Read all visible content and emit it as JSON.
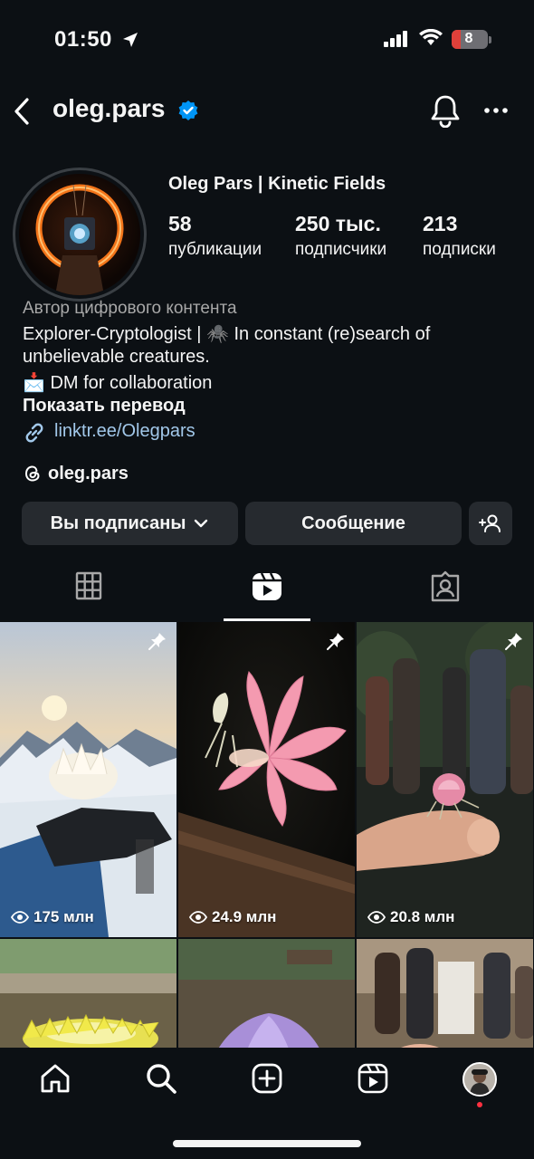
{
  "status_bar": {
    "time": "01:50",
    "battery_level": "8",
    "icons": [
      "location-arrow-icon",
      "signal-icon",
      "wifi-icon",
      "battery-icon"
    ]
  },
  "header": {
    "username": "oleg.pars",
    "verified": true,
    "icons": [
      "back-icon",
      "verified-icon",
      "bell-icon",
      "more-icon"
    ]
  },
  "profile": {
    "display_name": "Oleg Pars | Kinetic Fields",
    "stats": [
      {
        "value": "58",
        "label": "публикации"
      },
      {
        "value": "250 тыс.",
        "label": "подписчики"
      },
      {
        "value": "213",
        "label": "подписки"
      }
    ],
    "category": "Автор цифрового контента",
    "bio_lines": [
      "Explorer-Cryptologist | 🕷️ In constant (re)search of",
      "unbelievable creatures.",
      "📩 DM for collaboration"
    ],
    "translate_label": "Показать перевод",
    "link": "linktr.ee/Olegpars",
    "threads_handle": "oleg.pars"
  },
  "actions": {
    "following_label": "Вы подписаны",
    "message_label": "Сообщение"
  },
  "tabs": [
    {
      "name": "grid",
      "active": false
    },
    {
      "name": "reels",
      "active": true
    },
    {
      "name": "tagged",
      "active": false
    }
  ],
  "reels": [
    {
      "views": "175 млн",
      "pinned": true,
      "subject": "lotus flower mantis on glove in snowy mountains"
    },
    {
      "views": "24.9 млн",
      "pinned": true,
      "subject": "pink orchid mantis on branch"
    },
    {
      "views": "20.8 млн",
      "pinned": true,
      "subject": "pink flower mantis on finger"
    },
    {
      "views": "",
      "pinned": false,
      "subject": "yellow flower by pond"
    },
    {
      "views": "",
      "pinned": false,
      "subject": "purple flower by pond"
    },
    {
      "views": "",
      "pinned": false,
      "subject": "people at outdoor event"
    }
  ],
  "bottom_nav": [
    "home-icon",
    "search-icon",
    "create-icon",
    "reels-icon",
    "profile-avatar"
  ],
  "colors": {
    "background": "#0c1014",
    "button": "#262a2f",
    "link": "#a2c8ea",
    "verified": "#0095f6",
    "notification": "#ff3040"
  }
}
